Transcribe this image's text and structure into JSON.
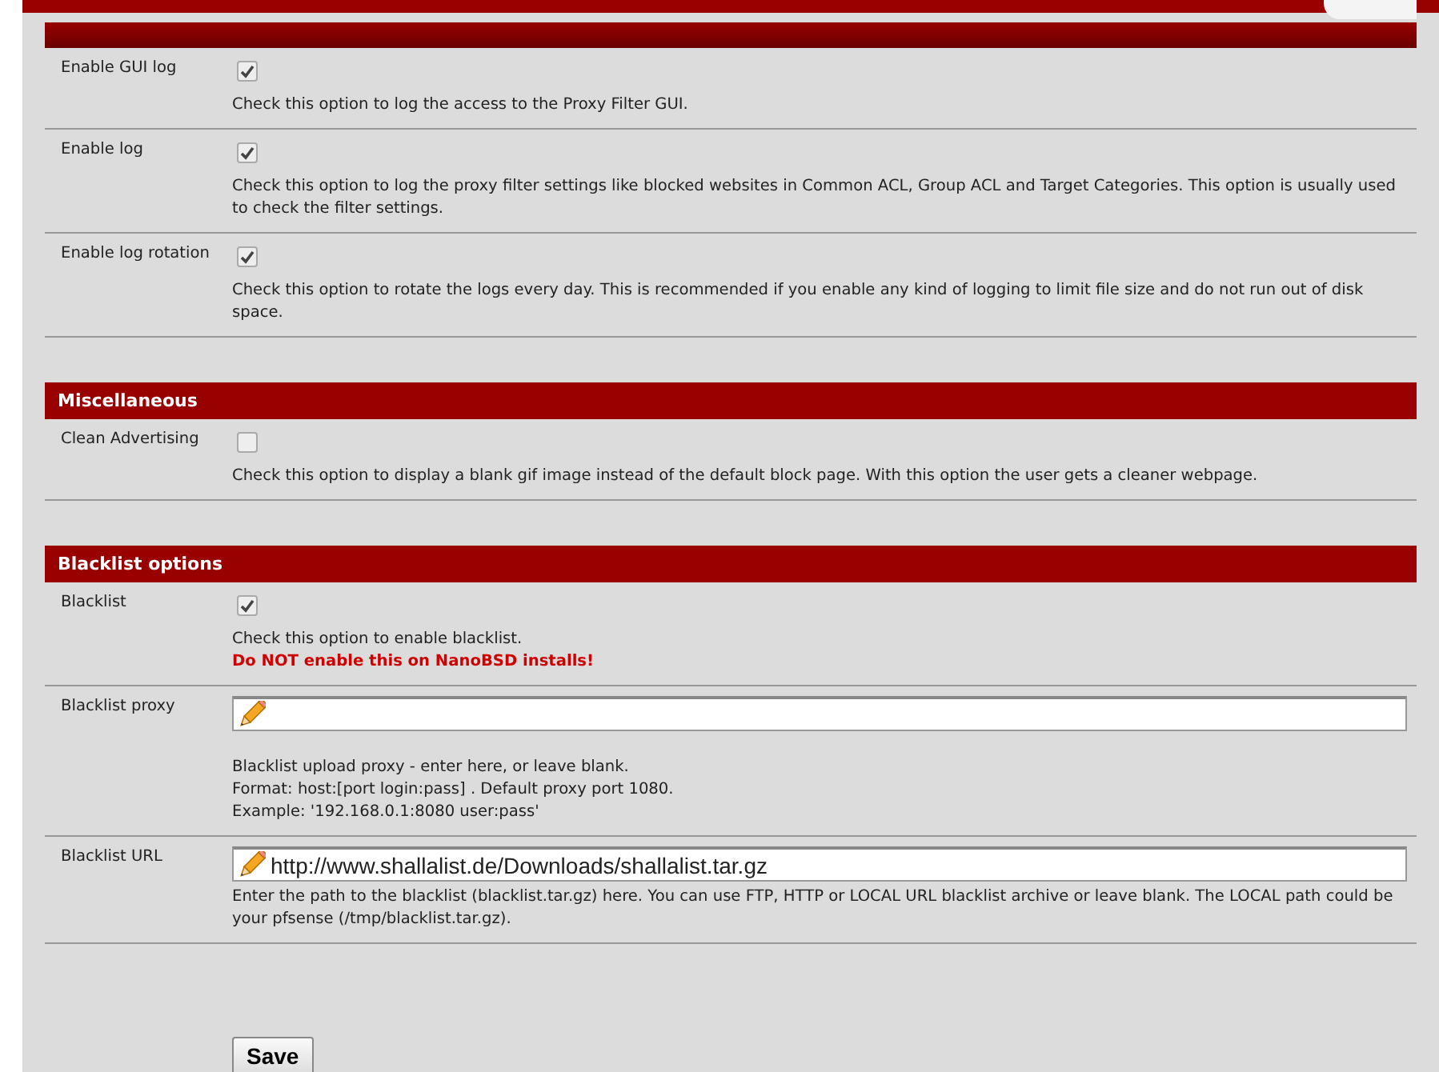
{
  "sections": [
    {
      "rows": [
        {
          "kind": "checkbox",
          "label": "Enable GUI log",
          "checked": true,
          "description": "Check this option to log the access to the Proxy Filter GUI."
        },
        {
          "kind": "checkbox",
          "label": "Enable log",
          "checked": true,
          "description": "Check this option to log the proxy filter settings like blocked websites in Common ACL, Group ACL and Target Categories. This option is usually used to check the filter settings."
        },
        {
          "kind": "checkbox",
          "label": "Enable log rotation",
          "checked": true,
          "description": "Check this option to rotate the logs every day. This is recommended if you enable any kind of logging to limit file size and do not run out of disk space."
        }
      ]
    },
    {
      "title": "Miscellaneous",
      "rows": [
        {
          "kind": "checkbox",
          "label": "Clean Advertising",
          "checked": false,
          "description": "Check this option to display a blank gif image instead of the default block page. With this option the user gets a cleaner webpage."
        }
      ]
    },
    {
      "title": "Blacklist options",
      "rows": [
        {
          "kind": "checkbox",
          "label": "Blacklist",
          "checked": true,
          "description": "Check this option to enable blacklist.",
          "warning": "Do NOT enable this on NanoBSD installs!"
        },
        {
          "kind": "text",
          "label": "Blacklist proxy",
          "description_lines": [
            "Blacklist upload proxy - enter here, or leave blank.",
            "Format: host:[port login:pass] . Default proxy port 1080.",
            "Example: '192.168.0.1:8080 user:pass'"
          ]
        },
        {
          "kind": "text",
          "label": "Blacklist URL",
          "value": "http://www.shallalist.de/Downloads/shallalist.tar.gz",
          "description_lines": [
            "Enter the path to the blacklist (blacklist.tar.gz) here. You can use FTP, HTTP or LOCAL URL blacklist archive or leave blank. The LOCAL path could be your pfsense (/tmp/blacklist.tar.gz)."
          ]
        }
      ]
    }
  ],
  "save_button": "Save"
}
